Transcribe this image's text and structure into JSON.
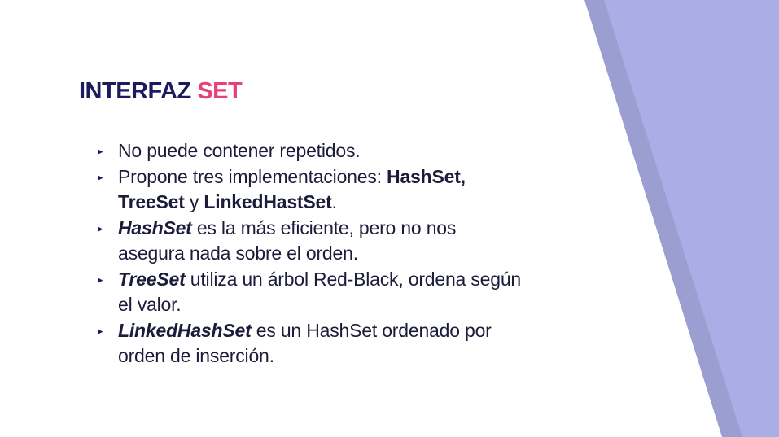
{
  "slide": {
    "title_main": "INTERFAZ",
    "title_accent": "SET",
    "colors": {
      "title": "#1b1b5e",
      "accent": "#e8407a",
      "band_light": "#aaaee6",
      "band_dark": "#9a9ed0"
    },
    "bullet_marker": "▸",
    "bullets": [
      {
        "parts": [
          "No puede contener repetidos."
        ]
      },
      {
        "parts": [
          "Propone tres implementaciones: ",
          "HashSet,",
          " ",
          "TreeSet",
          " y ",
          "LinkedHastSet",
          "."
        ]
      },
      {
        "parts": [
          "HashSet",
          " es la más eficiente, pero no nos asegura nada sobre el orden."
        ]
      },
      {
        "parts": [
          "TreeSet",
          " utiliza un árbol Red-Black, ordena según el valor."
        ]
      },
      {
        "parts": [
          "LinkedHashSet",
          " es un HashSet ordenado por orden de inserción."
        ]
      }
    ]
  }
}
